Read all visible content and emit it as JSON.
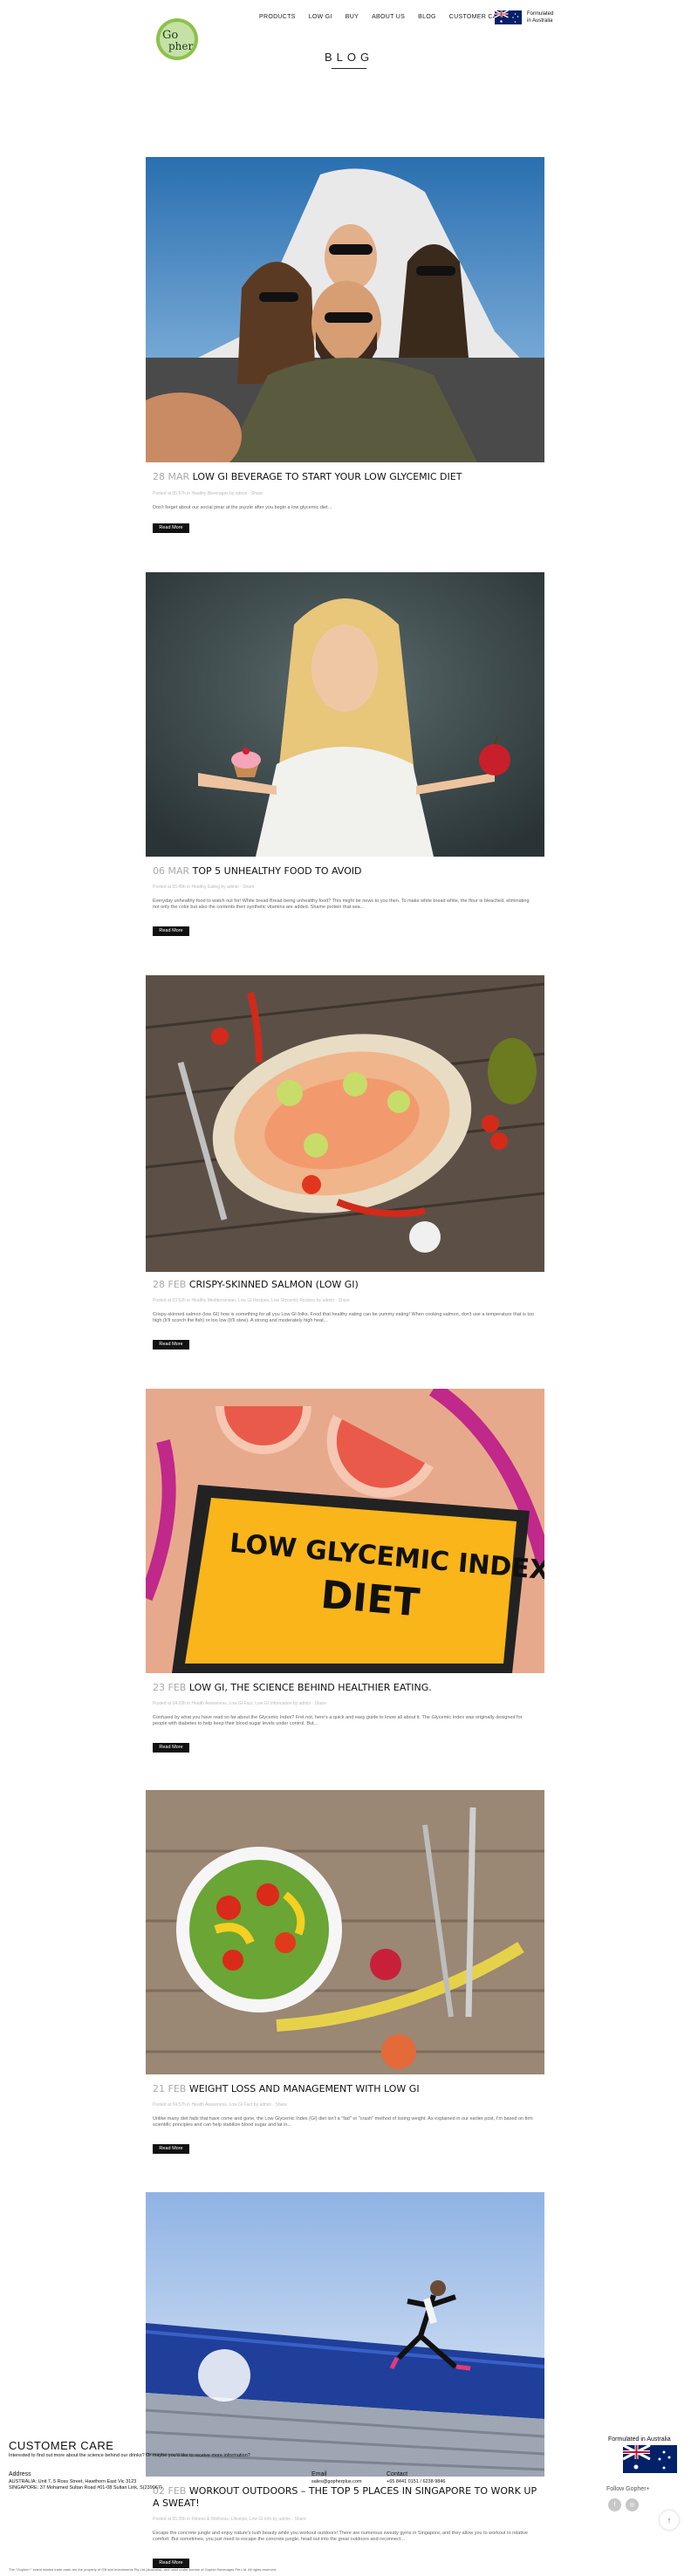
{
  "header": {
    "logo_text": "Gopher",
    "nav": [
      "PRODUCTS",
      "LOW GI",
      "BUY",
      "ABOUT US",
      "BLOG",
      "CUSTOMER CARE"
    ],
    "formulated_line1": "Formulated",
    "formulated_line2": "in Australia"
  },
  "page_title": "BLOG",
  "posts": [
    {
      "date": "28 MAR",
      "title": "LOW GI BEVERAGE TO START YOUR LOW GLYCEMIC DIET",
      "meta": "Posted at 05:57h in Healthy Beverages by admin · Share",
      "excerpt": "Don't forget about our social pinar at the puzzle after you begin a low glycemic diet...",
      "read_more": "Read More"
    },
    {
      "date": "06 MAR",
      "title": "TOP 5 UNHEALTHY FOOD TO AVOID",
      "meta": "Posted at 05:49h in Healthy Eating by admin · Share",
      "excerpt": "Everyday unhealthy food to watch out for! White bread Bread being unhealthy food? This might be news to you then. To make white bread white, the flour is bleached, eliminating not only the color but also the contents their synthetic vitamins are added. Shame protein that sea...",
      "read_more": "Read More"
    },
    {
      "date": "28 FEB",
      "title": "CRISPY-SKINNED SALMON (LOW GI)",
      "meta": "Posted at 03:52h in Healthy Mediterranean, Low GI Recipes, Low Glycemic Recipes by admin · Share",
      "excerpt": "Crispy-skinned salmon (low GI) how is something for all you Low GI folks. Food that healthy eating can be yummy eating! When cooking salmon, don't use a temperature that is too high (It'll scorch the fish) or too low (It'll stew). A strong and moderately high heat...",
      "read_more": "Read More"
    },
    {
      "date": "23 FEB",
      "title": "LOW GI, THE SCIENCE BEHIND HEALTHIER EATING.",
      "meta": "Posted at 04:22h in Health Awareness, Low GI Fact, Low GI Information by admin · Share",
      "excerpt": "Confused by what you have read so far about the Glycemic Index? Fret not, here's a quick and easy guide to know all about it. The Glycemic Index was originally designed for people with diabetes to help keep their blood sugar levels under control. But...",
      "read_more": "Read More"
    },
    {
      "date": "21 FEB",
      "title": "WEIGHT LOSS AND MANAGEMENT WITH LOW GI",
      "meta": "Posted at 04:57h in Health Awareness, Low GI Fact by admin · Share",
      "excerpt": "Unlike many diet fads that have come and gone, the Low Glycemic Index (GI) diet isn't a \"fad\" or \"crash\" method of losing weight. As explained in our earlier post, I'm based on firm scientific principles and can help stabilize blood sugar and lat in...",
      "read_more": "Read More"
    },
    {
      "date": "02 FEB",
      "title": "WORKOUT OUTDOORS – THE TOP 5 PLACES IN SINGAPORE TO WORK UP A SWEAT!",
      "meta": "Posted at 05:25h in Fitness & Wellness, Lifestyle, Low GI Info by admin · Share",
      "excerpt": "Escape the concrete jungle and enjoy nature's lush beauty while you workout outdoors! There are numerous sweaty gyms in Singapore, and they allow you to workout to relative comfort. But sometimes, you just need to escape the concrete jungle, head out into the great outdoors and reconnect...",
      "read_more": "Read More"
    }
  ],
  "footer": {
    "title": "CUSTOMER CARE",
    "subtitle": "Interested to find out more about the science behind our drinks? Or maybe you'd like to receive more information?",
    "address_heading": "Address",
    "address_line1": "AUSTRALIA: Unit 7, 5 Ross Street, Hawthorn East Vic 3123",
    "address_line2": "SINGAPORE: 37 Mohamed Sultan Road #01-08 Sultan Link, S(239067)",
    "email_heading": "Email",
    "email_value": "sales@gopherplus.com",
    "contact_heading": "Contact",
    "contact_value": "+65 8441 0151 / 6238 9846",
    "formulated": "Formulated in Australia",
    "follow": "Follow Gopher+",
    "copyright": "The \"Gopher+\" brand related trade mark are the property of GB and Investments Pty Ltd (Australia), and used under license of Gopher Beverages Pte Ltd. All rights reserved."
  },
  "colors": {
    "accent": "#111111",
    "date_grey": "#aaaaaa",
    "logo_green": "#7cb342"
  },
  "icons": {
    "social": [
      "facebook-icon",
      "instagram-icon"
    ],
    "back_to_top": "arrow-up-icon"
  }
}
